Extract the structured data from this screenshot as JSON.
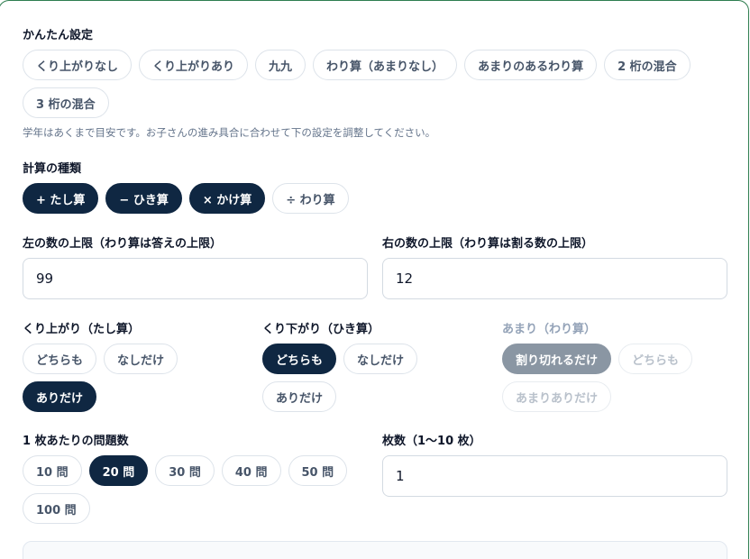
{
  "quick": {
    "title": "かんたん設定",
    "presets": [
      "くり上がりなし",
      "くり上がりあり",
      "九九",
      "わり算（あまりなし）",
      "あまりのあるわり算",
      "2 桁の混合",
      "3 桁の混合"
    ],
    "hint": "学年はあくまで目安です。お子さんの進み具合に合わせて下の設定を調整してください。"
  },
  "ops": {
    "title": "計算の種類",
    "items": [
      {
        "label": "+ たし算",
        "active": true
      },
      {
        "label": "− ひき算",
        "active": true
      },
      {
        "label": "× かけ算",
        "active": true
      },
      {
        "label": "÷ わり算",
        "active": false
      }
    ]
  },
  "limits": {
    "left_label": "左の数の上限（わり算は答えの上限）",
    "left_value": "99",
    "right_label": "右の数の上限（わり算は割る数の上限）",
    "right_value": "12"
  },
  "carry": {
    "title": "くり上がり（たし算）",
    "options": [
      "どちらも",
      "なしだけ",
      "ありだけ"
    ],
    "selected": 2
  },
  "borrow": {
    "title": "くり下がり（ひき算）",
    "options": [
      "どちらも",
      "なしだけ",
      "ありだけ"
    ],
    "selected": 0
  },
  "remainder": {
    "title": "あまり（わり算）",
    "options": [
      "割り切れるだけ",
      "どちらも",
      "あまりありだけ"
    ],
    "selected": 0,
    "disabled": true
  },
  "count": {
    "title": "1 枚あたりの問題数",
    "options": [
      "10 問",
      "20 問",
      "30 問",
      "40 問",
      "50 問",
      "100 問"
    ],
    "selected": 1
  },
  "sheets": {
    "label": "枚数（1〜10 枚）",
    "value": "1"
  }
}
